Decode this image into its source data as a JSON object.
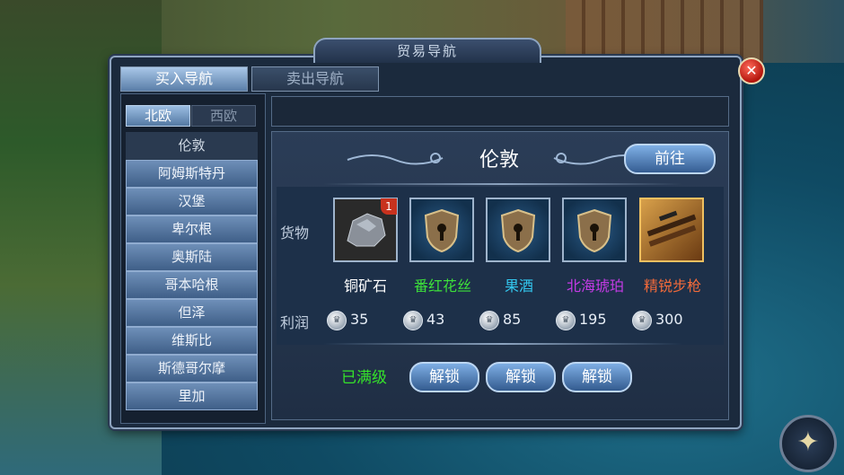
{
  "panel": {
    "title": "贸易导航",
    "close_icon": "✕"
  },
  "tabs": [
    {
      "label": "买入导航",
      "active": true
    },
    {
      "label": "卖出导航",
      "active": false
    }
  ],
  "regions": [
    {
      "label": "北欧",
      "active": true
    },
    {
      "label": "西欧",
      "active": false
    }
  ],
  "cities": [
    "伦敦",
    "阿姆斯特丹",
    "汉堡",
    "卑尔根",
    "奥斯陆",
    "哥本哈根",
    "但泽",
    "维斯比",
    "斯德哥尔摩",
    "里加"
  ],
  "selected_city": "伦敦",
  "detail": {
    "city": "伦敦",
    "go_button": "前往",
    "goods_label": "货物",
    "profit_label": "利润",
    "maxed_label": "已满级",
    "unlock_label": "解锁",
    "goods": [
      {
        "name": "铜矿石",
        "color": "#ffffff",
        "profit": "35",
        "icon": "ore-icon",
        "badge": "1"
      },
      {
        "name": "番红花丝",
        "color": "#3de13a",
        "profit": "43",
        "icon": "locked-shield-icon"
      },
      {
        "name": "果酒",
        "color": "#33c6ee",
        "profit": "85",
        "icon": "locked-shield-icon"
      },
      {
        "name": "北海琥珀",
        "color": "#c53be6",
        "profit": "195",
        "icon": "locked-shield-icon"
      },
      {
        "name": "精锐步枪",
        "color": "#f26a3a",
        "profit": "300",
        "icon": "rifle-icon"
      }
    ]
  },
  "compass_icon": "✦"
}
